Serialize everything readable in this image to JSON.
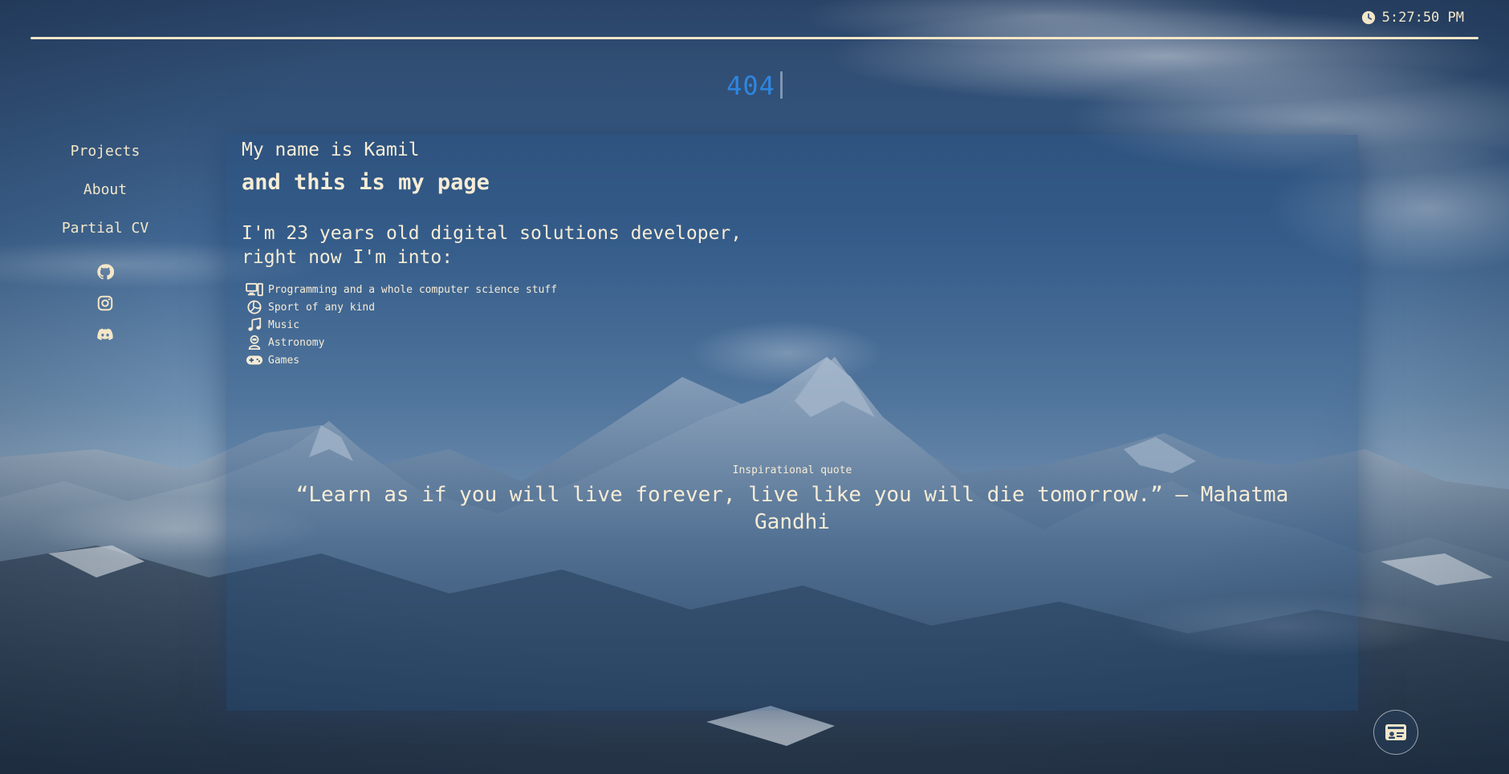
{
  "header": {
    "clock_icon": "clock-icon",
    "time": "5:27:50 PM",
    "title": "404"
  },
  "sidebar": {
    "nav": [
      {
        "label": "Projects"
      },
      {
        "label": "About"
      },
      {
        "label": "Partial CV"
      }
    ],
    "social_icons": [
      "github-icon",
      "instagram-icon",
      "discord-icon"
    ]
  },
  "content": {
    "intro_line1": "My name is Kamil",
    "intro_line2": "and this is my page",
    "about_text": "I'm 23 years old digital solutions developer,\nright now I'm into:",
    "interests": [
      {
        "icon": "computer-icon",
        "label": "Programming and a whole computer science stuff"
      },
      {
        "icon": "volleyball-icon",
        "label": "Sport of any kind"
      },
      {
        "icon": "music-note-icon",
        "label": "Music"
      },
      {
        "icon": "astronaut-icon",
        "label": "Astronomy"
      },
      {
        "icon": "gamepad-icon",
        "label": "Games"
      }
    ],
    "quote_caption": "Inspirational quote",
    "quote": "“Learn as if you will live forever, live like you will die tomorrow.” — Mahatma Gandhi"
  },
  "footer": {
    "card_button_icon": "id-card-icon"
  },
  "colors": {
    "text": "#f3e6c8",
    "accent_404": "#2f86e0",
    "panel_bg": "rgba(35,75,125,0.38)"
  }
}
